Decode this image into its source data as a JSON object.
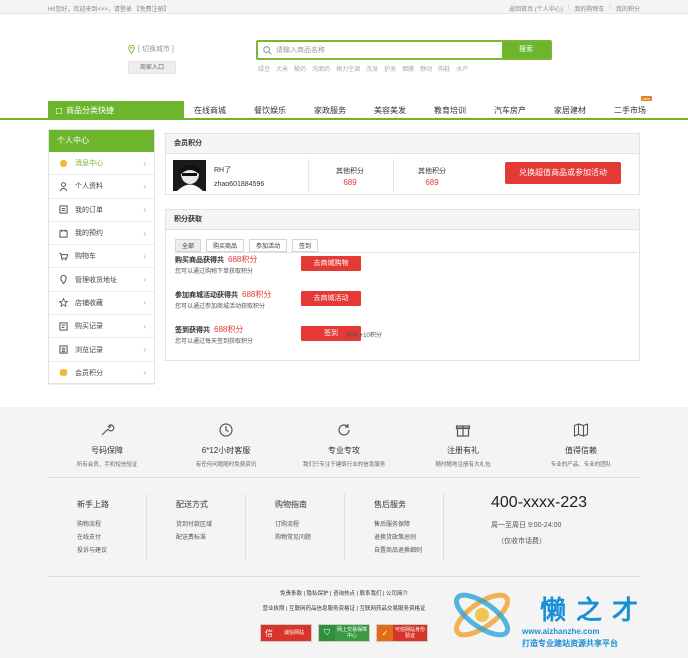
{
  "topbar": {
    "greeting": "Hi!您好，欢迎来到×××，请登录 【免费注册】",
    "links": [
      "返回首页 (个人中心)",
      "我的购物车",
      "我的积分"
    ]
  },
  "header": {
    "city": "[ 切换城市 ]",
    "merchant_btn": "商家入口",
    "search_placeholder": "请输入商品名称",
    "search_btn": "搜索",
    "hot": [
      "绿豆",
      "大米",
      "酸奶",
      "洗面奶",
      "格力空调",
      "洗发",
      "护发",
      "面膜",
      "静动",
      "购鞋",
      "水产"
    ]
  },
  "nav": {
    "category": "商品分类快捷",
    "items": [
      "在线商城",
      "餐饮娱乐",
      "家政服务",
      "美容美发",
      "教育培训",
      "汽车房产",
      "家居建材",
      "二手市场"
    ],
    "badge": "new"
  },
  "sidebar": {
    "title": "个人中心",
    "items": [
      {
        "label": "消息中心",
        "icon": "message-icon"
      },
      {
        "label": "个人资料",
        "icon": "user-icon"
      },
      {
        "label": "我的订单",
        "icon": "order-icon"
      },
      {
        "label": "我的预约",
        "icon": "appointment-icon"
      },
      {
        "label": "购物车",
        "icon": "cart-icon"
      },
      {
        "label": "管理收货地址",
        "icon": "location-icon"
      },
      {
        "label": "店铺收藏",
        "icon": "star-icon"
      },
      {
        "label": "购买记录",
        "icon": "purchase-icon"
      },
      {
        "label": "浏览记录",
        "icon": "browse-icon"
      },
      {
        "label": "会员积分",
        "icon": "coin-icon"
      }
    ],
    "arrow": "›"
  },
  "member": {
    "title": "会员积分",
    "name": "RH了",
    "account": "zhao601884596",
    "points": [
      {
        "label": "其他积分",
        "value": "689"
      },
      {
        "label": "其他积分",
        "value": "689"
      }
    ],
    "redeem_btn": "兑换超值商品或参加活动"
  },
  "earn": {
    "title": "积分获取",
    "tabs": [
      "全部",
      "购买商品",
      "参加活动",
      "签到"
    ],
    "items": [
      {
        "title": "购买商品获得共",
        "points": "688积分",
        "desc": "您可以通过购物下单获取积分",
        "btn": "去商城购物"
      },
      {
        "title": "参加商城活动获得共",
        "points": "688积分",
        "desc": "您可以通过参加商城活动获取积分",
        "btn": "去商城活动"
      },
      {
        "title": "签到获得共",
        "points": "688积分",
        "desc": "您可以通过每天签到获取积分",
        "btn": "签到"
      }
    ],
    "sign_note": "获得 +10积分"
  },
  "footer": {
    "services": [
      {
        "title": "号码保障",
        "desc": "所有会员，手机短信验证",
        "icon": "wrench-icon"
      },
      {
        "title": "6*12小时客服",
        "desc": "有任何问题随时免费资讯",
        "icon": "clock-icon"
      },
      {
        "title": "专业专攻",
        "desc": "我们只专注于建筑行业的信息服务",
        "icon": "refresh-icon"
      },
      {
        "title": "注册有礼",
        "desc": "随时随地注册有大礼包",
        "icon": "gift-icon"
      },
      {
        "title": "值得信赖",
        "desc": "专业的产品、专业的团队",
        "icon": "map-icon"
      }
    ],
    "columns": [
      {
        "title": "新手上路",
        "links": [
          "购物流程",
          "在线支付",
          "投诉与建议"
        ]
      },
      {
        "title": "配送方式",
        "links": [
          "货到付款区域",
          "配送费标准"
        ]
      },
      {
        "title": "购物指南",
        "links": [
          "订购流程",
          "购物常见问题"
        ]
      },
      {
        "title": "售后服务",
        "links": [
          "售后服务保障",
          "退换货政策总则",
          "自置商品退换细则"
        ]
      }
    ],
    "phone": "400-xxxx-223",
    "hours": "周一至周日 9:00-24:00",
    "hours_note": "（仅收市话费）",
    "links1": "免责条款 | 隐私保护 | 咨询热点 | 联系我们 | 公司简介",
    "links2": "营业执照 | 互联网药品信息服务资格证 | 互联网药品交易服务资格证",
    "badges": [
      "诚信网站",
      "网上交易保障中心",
      "可信网站身份验证"
    ],
    "badge_glyphs": [
      "信",
      "⛉",
      "✓"
    ],
    "watermark": "懒之才",
    "watermark_slogan": "打造专业建站资源共享平台",
    "watermark_url": "www.aizhanzhe.com"
  }
}
